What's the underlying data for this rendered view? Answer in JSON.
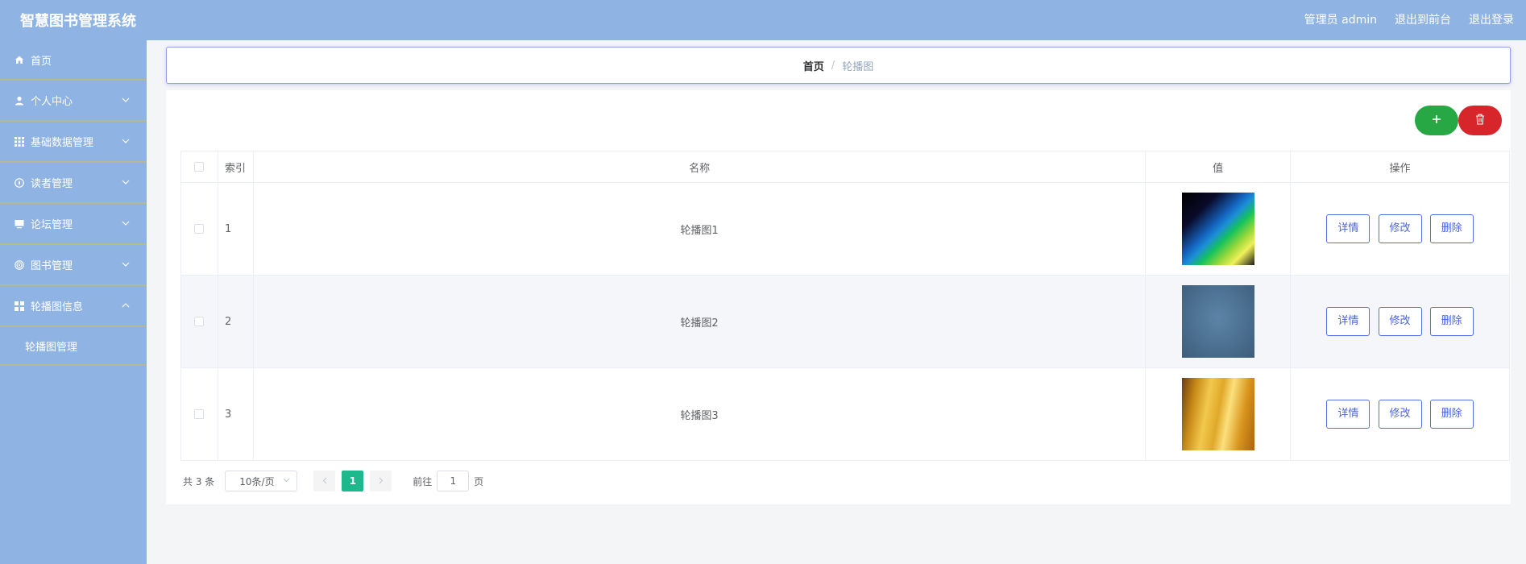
{
  "header": {
    "title": "智慧图书管理系统",
    "admin_label": "管理员 admin",
    "exit_front": "退出到前台",
    "logout": "退出登录"
  },
  "sidebar": {
    "items": [
      {
        "label": "首页",
        "icon": "home-icon"
      },
      {
        "label": "个人中心",
        "icon": "user-icon",
        "expanded": false
      },
      {
        "label": "基础数据管理",
        "icon": "grid-icon",
        "expanded": false
      },
      {
        "label": "读者管理",
        "icon": "compass-icon",
        "expanded": false
      },
      {
        "label": "论坛管理",
        "icon": "monitor-icon",
        "expanded": false
      },
      {
        "label": "图书管理",
        "icon": "target-icon",
        "expanded": false
      },
      {
        "label": "轮播图信息",
        "icon": "apps-icon",
        "expanded": true
      }
    ],
    "submenu": [
      {
        "label": "轮播图管理"
      }
    ]
  },
  "breadcrumb": {
    "home": "首页",
    "separator": "/",
    "current": "轮播图"
  },
  "table": {
    "columns": [
      "索引",
      "名称",
      "值",
      "操作"
    ],
    "rows": [
      {
        "index": "1",
        "name": "轮播图1",
        "image": "abstract-green-light-streaks"
      },
      {
        "index": "2",
        "name": "轮播图2",
        "image": "blue-gray-texture"
      },
      {
        "index": "3",
        "name": "轮播图3",
        "image": "golden-blur"
      }
    ],
    "actions": {
      "detail": "详情",
      "edit": "修改",
      "delete": "删除"
    }
  },
  "pagination": {
    "total": "共 3 条",
    "page_size": "10条/页",
    "current_page": "1",
    "goto_label": "前往",
    "goto_value": "1",
    "page_unit": "页"
  },
  "colors": {
    "header_bg": "#8fb4e3",
    "sidebar_bg": "#8fb4e3",
    "add_button": "#27a844",
    "delete_button": "#d7262b",
    "page_active": "#1fb88c",
    "action_border": "#5470e6"
  }
}
